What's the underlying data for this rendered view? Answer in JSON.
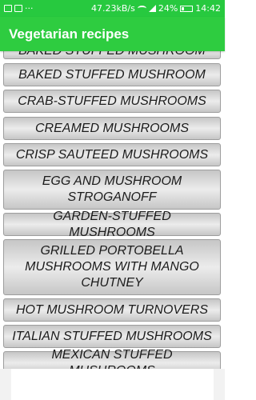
{
  "status_bar": {
    "speed": "47.23kB/s",
    "battery": "24%",
    "time": "14:42",
    "icons_left": [
      "image-icon",
      "lock-icon",
      "more-icon"
    ],
    "icons_right": [
      "wifi-icon",
      "signal-icon",
      "battery-icon"
    ]
  },
  "toolbar": {
    "title": "Vegetarian recipes"
  },
  "colors": {
    "accent": "#2ecc40",
    "status_bar": "#27c93f",
    "item_border": "#9d9d9d"
  },
  "recipes": [
    "BAKED STUFFED MUSHROOM",
    "BAKED STUFFED MUSHROOM",
    "CRAB-STUFFED MUSHROOMS",
    "CREAMED MUSHROOMS",
    "CRISP SAUTEED MUSHROOMS",
    "EGG AND MUSHROOM STROGANOFF",
    "GARDEN-STUFFED MUSHROOMS",
    "GRILLED PORTOBELLA MUSHROOMS WITH MANGO CHUTNEY",
    "HOT MUSHROOM TURNOVERS",
    "ITALIAN STUFFED MUSHROOMS",
    "MEXICAN STUFFED MUSHROOMS"
  ]
}
